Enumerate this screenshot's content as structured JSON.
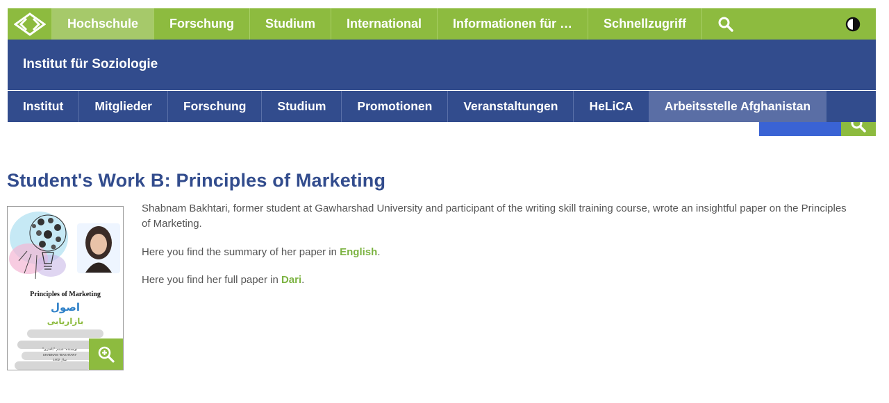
{
  "colors": {
    "brand_green": "#8dbb3f",
    "brand_blue": "#324c8d",
    "link_green": "#7cb342",
    "text_grey": "#555555"
  },
  "top_nav": {
    "logo_icon": "diamond-chevrons-logo",
    "items": [
      "Hochschule",
      "Forschung",
      "Studium",
      "International",
      "Informationen für …",
      "Schnellzugriff"
    ],
    "active_index": 0,
    "search_icon": "search-icon",
    "contrast_icon": "contrast-icon"
  },
  "institute": {
    "title": "Institut für Soziologie"
  },
  "sub_nav": {
    "items": [
      "Institut",
      "Mitglieder",
      "Forschung",
      "Studium",
      "Promotionen",
      "Veranstaltungen",
      "HeLiCA",
      "Arbeitsstelle Afghanistan"
    ],
    "active_index": 7
  },
  "content": {
    "title": "Student's Work B: Principles of Marketing",
    "thumbnail": {
      "book_title": "Principles of Marketing",
      "arabic_line1": "اصول",
      "arabic_line2": "بازاریابی",
      "author_line1": "نویسنده: شبنم \"باختری\"",
      "author_line2": "SHABNAM \"BAKHTARI\"",
      "author_line3": "سال 1402",
      "zoom_icon": "zoom-in-icon"
    },
    "paragraph1": "Shabnam Bakhtari, former student at Gawharshad University and participant of the writing skill training course, wrote an insightful paper on the Principles of Marketing.",
    "paragraph2_prefix": "Here you find the summary of her paper in ",
    "paragraph2_link": "English",
    "paragraph2_suffix": ".",
    "paragraph3_prefix": "Here you find her full paper in ",
    "paragraph3_link": "Dari",
    "paragraph3_suffix": "."
  }
}
